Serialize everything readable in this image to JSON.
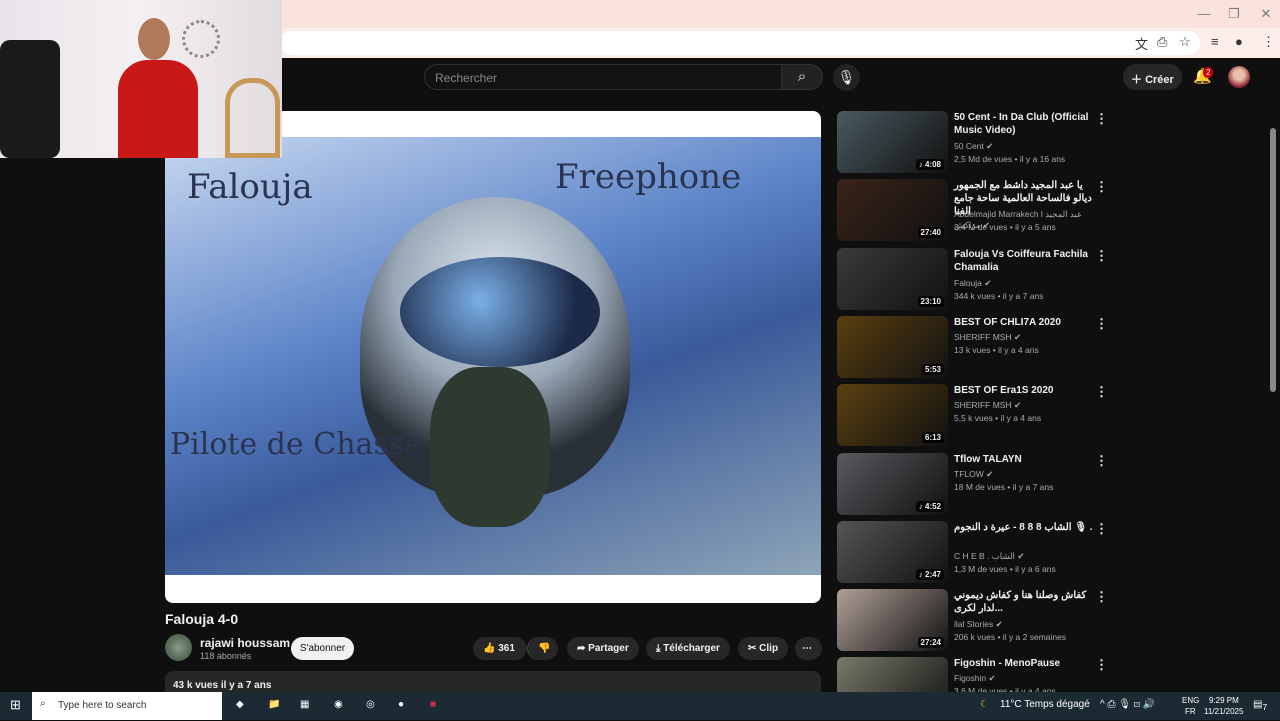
{
  "search": {
    "placeholder": "Rechercher"
  },
  "header": {
    "create_label": "Créer",
    "notification_count": "2"
  },
  "video": {
    "overlay_left": "Falouja",
    "overlay_right": "Freephone",
    "overlay_bottom": "Pilote de Chasse",
    "title": "Falouja 4-0",
    "channel": "rajawi houssam",
    "subscribers": "118 abonnés",
    "subscribe_label": "S'abonner",
    "likes": "361",
    "share_label": "Partager",
    "download_label": "Télécharger",
    "clip_label": "Clip",
    "views_date": "43 k vues  il y a 7 ans"
  },
  "recommendations": [
    {
      "title": "50 Cent - In Da Club (Official Music Video)",
      "channel": "50 Cent",
      "meta": "2,5 Md de vues • il y a 16 ans",
      "duration": "♪ 4:08",
      "color": "#4a5a60"
    },
    {
      "title": "يا عبد المجيد داشط مع الجمهور ديالو فالساحة العالمية ساحة جامع الفنا",
      "channel": "Abdelmajid Marrakech l عبد المجيد مراكش",
      "meta": "3,4 M de vues • il y a 5 ans",
      "duration": "27:40",
      "color": "#3a2418"
    },
    {
      "title": "Falouja Vs Coiffeura Fachila Chamalia",
      "channel": "Falouja",
      "meta": "344 k vues • il y a 7 ans",
      "duration": "23:10",
      "color": "#3a3a3a"
    },
    {
      "title": "BEST OF CHLI7A 2020",
      "channel": "SHERIFF MSH",
      "meta": "13 k vues • il y a 4 ans",
      "duration": "5:53",
      "color": "#5a4010"
    },
    {
      "title": "BEST OF  Era1S  2020",
      "channel": "SHERIFF MSH",
      "meta": "5,5 k vues • il y a 4 ans",
      "duration": "6:13",
      "color": "#5a4010"
    },
    {
      "title": "Tflow TALAYN",
      "channel": "TFLOW",
      "meta": "18 M de vues • il y a 7 ans",
      "duration": "♪ 4:52",
      "color": "#5a5a60"
    },
    {
      "title": "الشاب 8 8 8 - عيرة د النجوم 🎙 .",
      "channel": "C H E B . الشاب",
      "meta": "1,3 M de vues • il y a 6 ans",
      "duration": "♪ 2:47",
      "color": "#555"
    },
    {
      "title": "كفاش وصلنا هنا و كفاش ديموني لدار لكرى...",
      "channel": "ilal Stories",
      "meta": "206 k vues • il y a 2 semaines",
      "duration": "27:24",
      "color": "#b0a098"
    },
    {
      "title": "Figoshin - MenoPause",
      "channel": "Figoshin",
      "meta": "3,6 M de vues • il y a 4 ans",
      "duration": "",
      "color": "#7a7a6a"
    }
  ],
  "taskbar": {
    "search_placeholder": "Type here to search",
    "weather": "11°C  Temps dégagé",
    "lang1": "ENG",
    "lang2": "FR",
    "time": "9:29 PM",
    "date": "11/21/2025",
    "notif": "7"
  }
}
